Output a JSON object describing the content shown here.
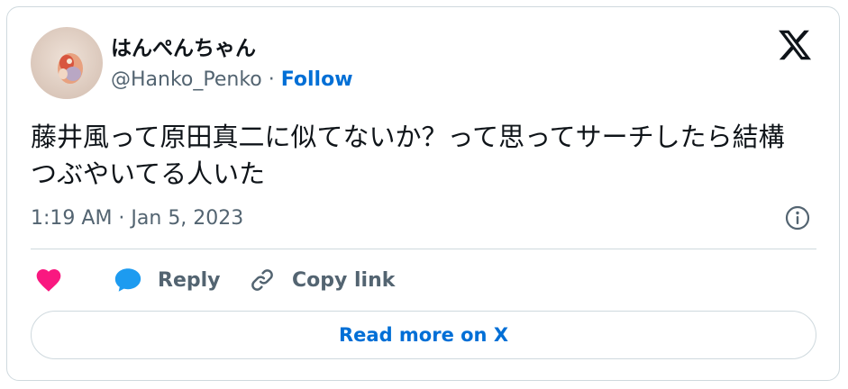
{
  "author": {
    "display_name": "はんぺんちゃん",
    "handle": "@Hanko_Penko",
    "separator": "·",
    "follow_label": "Follow"
  },
  "tweet": {
    "text": "藤井風って原田真二に似てないか？って思ってサーチしたら結構つぶやいてる人いた",
    "timestamp": "1:19 AM · Jan 5, 2023"
  },
  "actions": {
    "reply_label": "Reply",
    "copy_link_label": "Copy link"
  },
  "read_more_label": "Read more on X",
  "colors": {
    "link_blue": "#006fd6",
    "heart_pink": "#f91880",
    "reply_blue": "#1d9bf0",
    "muted_text": "#536471",
    "border": "#cfd9de"
  },
  "icons": [
    "x-logo-icon",
    "info-icon",
    "heart-icon",
    "reply-bubble-icon",
    "link-icon"
  ]
}
